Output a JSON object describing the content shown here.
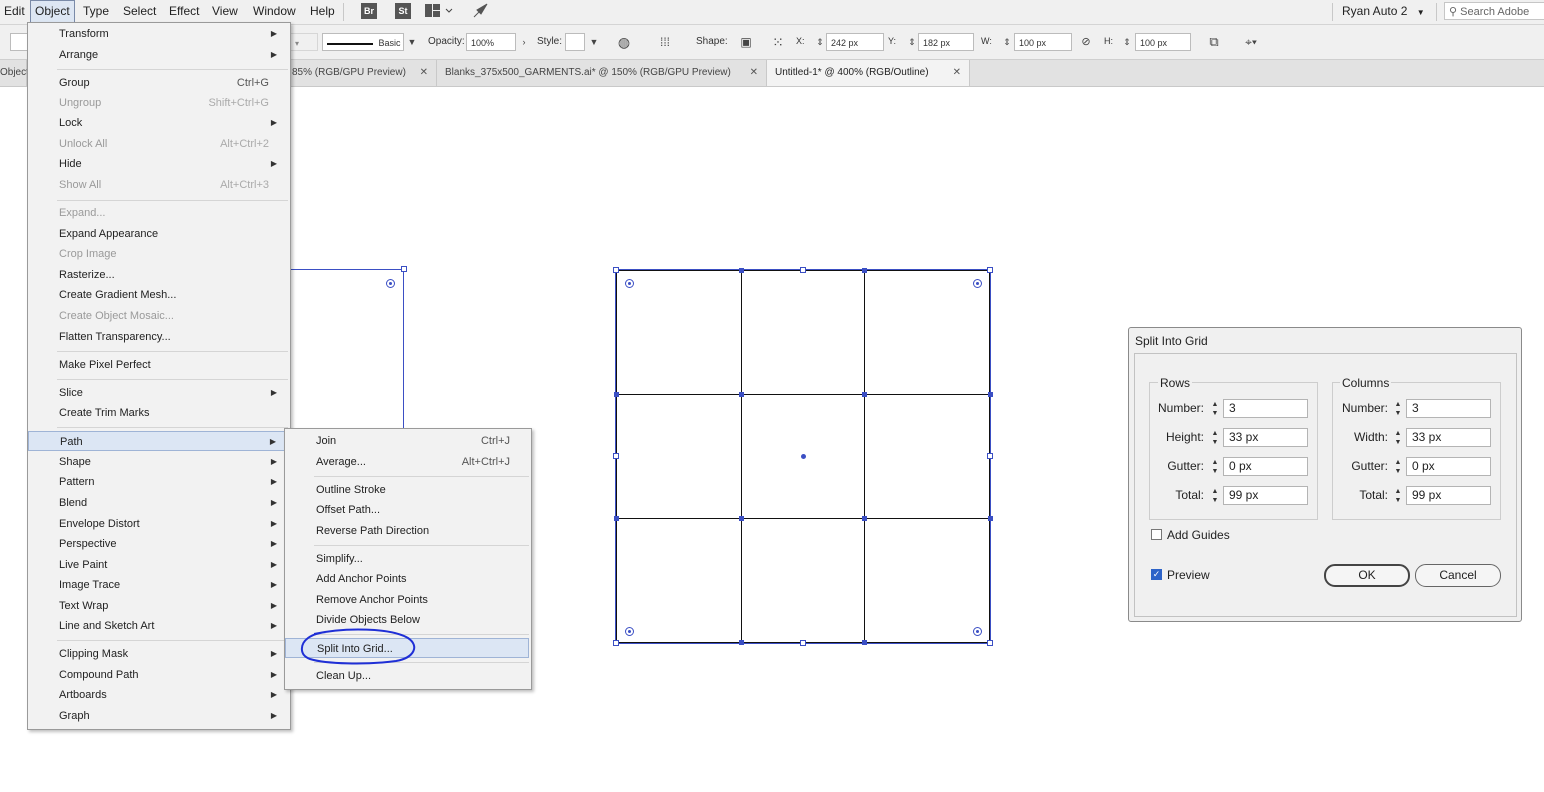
{
  "menubar": {
    "items": [
      "Edit",
      "Object",
      "Type",
      "Select",
      "Effect",
      "View",
      "Window",
      "Help"
    ],
    "bridge_icon": "Br",
    "stock_icon": "St",
    "workspace": "Ryan Auto 2",
    "search_placeholder": "Search Adobe Stock"
  },
  "controlbar": {
    "stroke_style": "Basic",
    "opacity_label": "Opacity:",
    "opacity_value": "100%",
    "style_label": "Style:",
    "shape_label": "Shape:",
    "x_label": "X:",
    "x_value": "242 px",
    "y_label": "Y:",
    "y_value": "182 px",
    "w_label": "W:",
    "w_value": "100 px",
    "h_label": "H:",
    "h_value": "100 px"
  },
  "tabs": [
    {
      "label": "Object",
      "partial": true
    },
    {
      "label": "85% (RGB/GPU Preview)"
    },
    {
      "label": "Blanks_375x500_GARMENTS.ai* @ 150% (RGB/GPU Preview)"
    },
    {
      "label": "Untitled-1* @ 400% (RGB/Outline)",
      "active": true
    }
  ],
  "object_menu": {
    "items": [
      {
        "label": "Transform",
        "submenu": true
      },
      {
        "label": "Arrange",
        "submenu": true
      },
      {
        "label": "Group",
        "shortcut": "Ctrl+G"
      },
      {
        "label": "Ungroup",
        "shortcut": "Shift+Ctrl+G",
        "disabled": true
      },
      {
        "label": "Lock",
        "submenu": true
      },
      {
        "label": "Unlock All",
        "shortcut": "Alt+Ctrl+2",
        "disabled": true
      },
      {
        "label": "Hide",
        "submenu": true
      },
      {
        "label": "Show All",
        "shortcut": "Alt+Ctrl+3",
        "disabled": true
      },
      {
        "label": "Expand...",
        "disabled": true
      },
      {
        "label": "Expand Appearance"
      },
      {
        "label": "Crop Image",
        "disabled": true
      },
      {
        "label": "Rasterize..."
      },
      {
        "label": "Create Gradient Mesh..."
      },
      {
        "label": "Create Object Mosaic...",
        "disabled": true
      },
      {
        "label": "Flatten Transparency..."
      },
      {
        "label": "Make Pixel Perfect"
      },
      {
        "label": "Slice",
        "submenu": true
      },
      {
        "label": "Create Trim Marks"
      },
      {
        "label": "Path",
        "submenu": true,
        "highlighted": true
      },
      {
        "label": "Shape",
        "submenu": true
      },
      {
        "label": "Pattern",
        "submenu": true
      },
      {
        "label": "Blend",
        "submenu": true
      },
      {
        "label": "Envelope Distort",
        "submenu": true
      },
      {
        "label": "Perspective",
        "submenu": true
      },
      {
        "label": "Live Paint",
        "submenu": true
      },
      {
        "label": "Image Trace",
        "submenu": true
      },
      {
        "label": "Text Wrap",
        "submenu": true
      },
      {
        "label": "Line and Sketch Art",
        "submenu": true
      },
      {
        "label": "Clipping Mask",
        "submenu": true
      },
      {
        "label": "Compound Path",
        "submenu": true
      },
      {
        "label": "Artboards",
        "submenu": true
      },
      {
        "label": "Graph",
        "submenu": true
      }
    ]
  },
  "path_menu": {
    "items": [
      {
        "label": "Join",
        "shortcut": "Ctrl+J"
      },
      {
        "label": "Average...",
        "shortcut": "Alt+Ctrl+J"
      },
      {
        "label": "Outline Stroke"
      },
      {
        "label": "Offset Path..."
      },
      {
        "label": "Reverse Path Direction"
      },
      {
        "label": "Simplify..."
      },
      {
        "label": "Add Anchor Points"
      },
      {
        "label": "Remove Anchor Points"
      },
      {
        "label": "Divide Objects Below"
      },
      {
        "label": "Split Into Grid...",
        "highlighted": true,
        "circled": true
      },
      {
        "label": "Clean Up..."
      }
    ]
  },
  "dialog": {
    "title": "Split Into Grid",
    "rows": {
      "heading": "Rows",
      "number_label": "Number:",
      "number": "3",
      "height_label": "Height:",
      "height": "33 px",
      "gutter_label": "Gutter:",
      "gutter": "0 px",
      "total_label": "Total:",
      "total": "99 px"
    },
    "columns": {
      "heading": "Columns",
      "number_label": "Number:",
      "number": "3",
      "width_label": "Width:",
      "width": "33 px",
      "gutter_label": "Gutter:",
      "gutter": "0 px",
      "total_label": "Total:",
      "total": "99 px"
    },
    "add_guides_label": "Add Guides",
    "add_guides_checked": false,
    "preview_label": "Preview",
    "preview_checked": true,
    "ok_label": "OK",
    "cancel_label": "Cancel"
  },
  "colors": {
    "selection": "#3b4fc4",
    "annotation": "#1f2fd6",
    "menu_highlight": "#dce6f4"
  }
}
